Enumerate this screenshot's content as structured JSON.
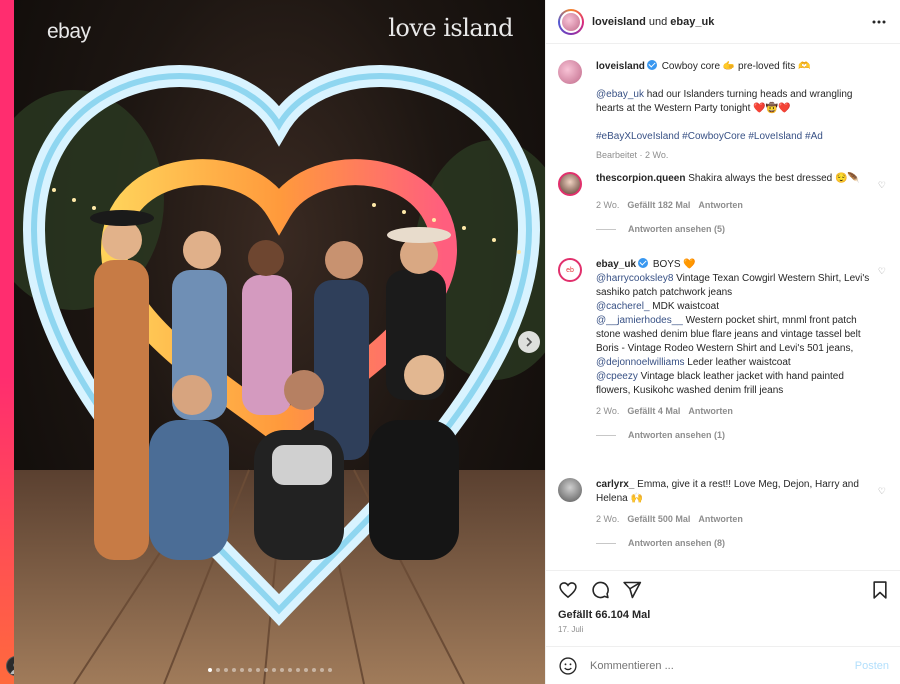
{
  "media": {
    "watermark_left": "ebay",
    "watermark_right": "love island",
    "carousel_count": 16,
    "carousel_active": 0
  },
  "header": {
    "user1": "loveisland",
    "und": "und",
    "user2": "ebay_uk"
  },
  "caption": {
    "username": "loveisland",
    "text": "Cowboy core 🫱 pre-loved fits 🫶",
    "mention": "@ebay_uk",
    "body": " had our Islanders turning heads and wrangling hearts at the Western Party tonight ❤️🤠❤️",
    "hashtags": "#eBayXLoveIsland #CowboyCore #LoveIsland #Ad",
    "meta": "Bearbeitet · 2 Wo."
  },
  "comments": [
    {
      "username": "thescorpion.queen",
      "text": "Shakira always the best dressed 😌🪶",
      "age": "2 Wo.",
      "likes": "Gefällt 182 Mal",
      "reply_label": "Antworten",
      "view_replies": "Antworten ansehen (5)"
    },
    {
      "username": "ebay_uk",
      "text_intro": "BOYS 🧡",
      "lines": [
        {
          "mention": "@harrycooksley8",
          "text": " Vintage Texan Cowgirl Western Shirt, Levi's sashiko patch patchwork jeans"
        },
        {
          "mention": "@cacherel_",
          "text": " MDK waistcoat"
        },
        {
          "mention": "@__jamierhodes__",
          "text": " Western pocket shirt, mnml front patch stone washed denim blue flare jeans and vintage tassel belt"
        },
        {
          "mention": "",
          "text": "Boris - Vintage Rodeo Western Shirt and Levi's 501 jeans,"
        },
        {
          "mention": "@dejonnoelwilliams",
          "text": " Leder leather waistcoat"
        },
        {
          "mention": "@cpeezy",
          "text": " Vintage black leather jacket with hand painted flowers, Kusikohc washed denim frill jeans"
        }
      ],
      "age": "2 Wo.",
      "likes": "Gefällt 4 Mal",
      "reply_label": "Antworten",
      "view_replies": "Antworten ansehen (1)"
    },
    {
      "username": "carlyrx_",
      "text": "Emma, give it a rest!! Love Meg, Dejon, Harry and Helena 🙌",
      "age": "2 Wo.",
      "likes": "Gefällt 500 Mal",
      "reply_label": "Antworten",
      "view_replies": "Antworten ansehen (8)"
    }
  ],
  "footer": {
    "likes": "Gefällt 66.104 Mal",
    "date": "17. Juli",
    "comment_placeholder": "Kommentieren ...",
    "post_label": "Posten"
  },
  "colors": {
    "link": "#385185",
    "verified": "#3897f0",
    "post_disabled": "#b2dffc"
  }
}
